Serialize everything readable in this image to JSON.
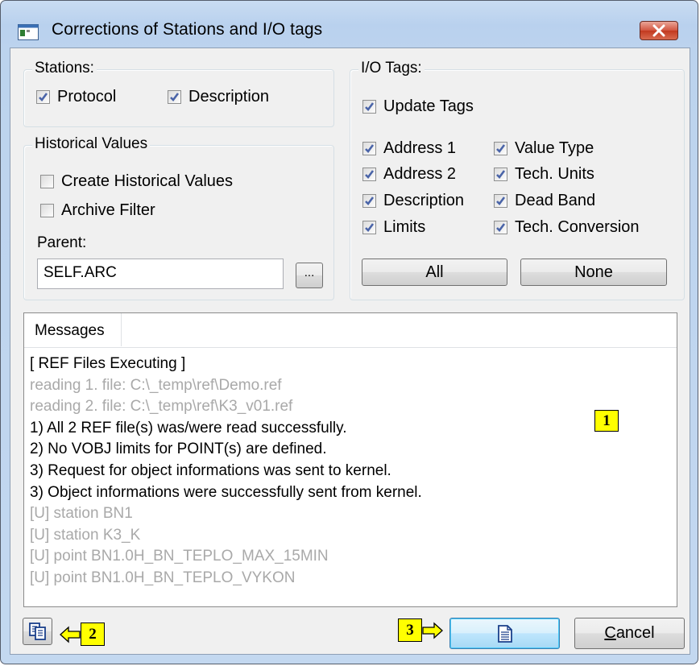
{
  "window": {
    "title": "Corrections of Stations and I/O tags"
  },
  "stations": {
    "legend": "Stations:",
    "protocol": {
      "label": "Protocol",
      "checked": true
    },
    "description": {
      "label": "Description",
      "checked": true
    }
  },
  "historical": {
    "legend": "Historical Values",
    "create": {
      "label": "Create Historical Values",
      "checked": false
    },
    "archive": {
      "label": "Archive Filter",
      "checked": false
    },
    "parent_label": "Parent:",
    "parent_value": "SELF.ARC",
    "browse_label": "..."
  },
  "io_tags": {
    "legend": "I/O Tags:",
    "update": {
      "label": "Update Tags",
      "checked": true
    },
    "left": [
      {
        "label": "Address 1",
        "checked": true
      },
      {
        "label": "Address 2",
        "checked": true
      },
      {
        "label": "Description",
        "checked": true
      },
      {
        "label": "Limits",
        "checked": true
      }
    ],
    "right": [
      {
        "label": "Value Type",
        "checked": true
      },
      {
        "label": "Tech. Units",
        "checked": true
      },
      {
        "label": "Dead Band",
        "checked": true
      },
      {
        "label": "Tech. Conversion",
        "checked": true
      }
    ],
    "all_label": "All",
    "none_label": "None"
  },
  "messages": {
    "header": "Messages",
    "lines": [
      {
        "text": "[ REF Files Executing ]",
        "tone": "dark"
      },
      {
        "text": "reading 1. file: C:\\_temp\\ref\\Demo.ref",
        "tone": "grey"
      },
      {
        "text": "reading 2. file: C:\\_temp\\ref\\K3_v01.ref",
        "tone": "grey"
      },
      {
        "text": "1) All 2 REF file(s) was/were read successfully.",
        "tone": "dark"
      },
      {
        "text": "2) No VOBJ limits for POINT(s) are defined.",
        "tone": "dark"
      },
      {
        "text": "3) Request for object informations was sent to kernel.",
        "tone": "dark"
      },
      {
        "text": "3) Object informations were successfully sent from kernel.",
        "tone": "dark"
      },
      {
        "text": "[U] station BN1",
        "tone": "grey"
      },
      {
        "text": "[U] station K3_K",
        "tone": "grey"
      },
      {
        "text": "[U] point BN1.0H_BN_TEPLO_MAX_15MIN",
        "tone": "grey"
      },
      {
        "text": "[U] point BN1.0H_BN_TEPLO_VYKON",
        "tone": "grey"
      }
    ]
  },
  "footer": {
    "cancel_label": "Cancel",
    "cancel_mnemonic": "C",
    "cancel_rest": "ancel"
  },
  "callouts": {
    "one": "1",
    "two": "2",
    "three": "3"
  },
  "icons": {
    "app": "window-app-icon",
    "close": "close-x-icon",
    "copy": "copy-documents-icon",
    "ok": "document-icon",
    "arrow": "arrow-left-icon"
  },
  "colors": {
    "check": "#4a64a8",
    "callout": "#ffff00",
    "grey_text": "#a9a9a9"
  }
}
